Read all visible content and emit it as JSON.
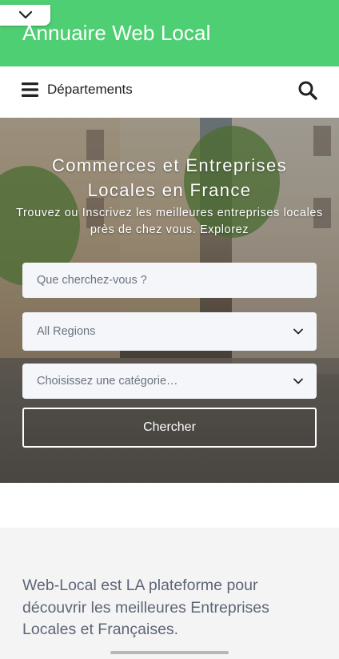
{
  "header": {
    "title": "Annuaire Web Local",
    "brand_color": "#4fcf73",
    "collapse_icon": "chevron-down-icon"
  },
  "nav": {
    "menu_label": "Départements",
    "menu_icon": "hamburger-icon",
    "search_icon": "search-icon"
  },
  "hero": {
    "title": "Commerces et Entreprises Locales en France",
    "subtitle": "Trouvez ou Inscrivez les meilleures entreprises locales près de chez vous. Explorez",
    "search_placeholder": "Que cherchez-vous ?",
    "region_selected": "All Regions",
    "category_placeholder": "Choisissez une catégorie…",
    "submit_label": "Chercher"
  },
  "about": {
    "text": "Web-Local est LA plateforme pour découvrir les meilleures Entreprises Locales et Françaises."
  }
}
